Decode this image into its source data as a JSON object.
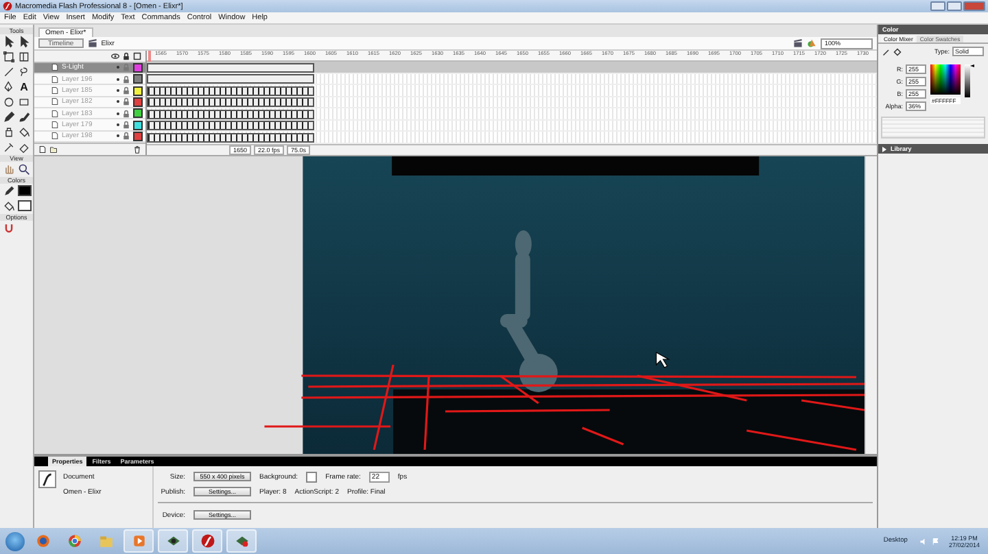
{
  "window": {
    "title": "Macromedia Flash Professional 8 - [Omen - Elixr*]"
  },
  "menu": [
    "File",
    "Edit",
    "View",
    "Insert",
    "Modify",
    "Text",
    "Commands",
    "Control",
    "Window",
    "Help"
  ],
  "tools": {
    "title": "Tools",
    "text_tool": "A",
    "view_label": "View",
    "colors_label": "Colors",
    "options_label": "Options"
  },
  "document_tab": {
    "label": "Omen - Elixr*",
    "selected": true
  },
  "edit_bar": {
    "timeline_button": "Timeline",
    "scene": "Elixr",
    "zoom": "100%"
  },
  "timeline": {
    "ruler": [
      "1565",
      "1570",
      "1575",
      "1580",
      "1585",
      "1590",
      "1595",
      "1600",
      "1605",
      "1610",
      "1615",
      "1620",
      "1625",
      "1630",
      "1635",
      "1640",
      "1645",
      "1650",
      "1655",
      "1660",
      "1665",
      "1670",
      "1675",
      "1680",
      "1685",
      "1690",
      "1695",
      "1700",
      "1705",
      "1710",
      "1715",
      "1720",
      "1725",
      "1730"
    ],
    "layers": [
      {
        "name": "S-Light",
        "selected": true,
        "color": "#e040e0"
      },
      {
        "name": "Layer 196",
        "selected": false,
        "color": "#808080"
      },
      {
        "name": "Layer 185",
        "selected": false,
        "color": "#f0f040"
      },
      {
        "name": "Layer 182",
        "selected": false,
        "color": "#e04040"
      },
      {
        "name": "Layer 183",
        "selected": false,
        "color": "#40d040"
      },
      {
        "name": "Layer 179",
        "selected": false,
        "color": "#40e0e0"
      },
      {
        "name": "Layer 198",
        "selected": false,
        "color": "#e04040"
      }
    ],
    "current_frame": "1650",
    "frame_rate": "22.0 fps",
    "elapsed": "75.0s"
  },
  "color_panel": {
    "title": "Color",
    "tabs": [
      {
        "label": "Color Mixer",
        "selected": true
      },
      {
        "label": "Color Swatches",
        "selected": false
      }
    ],
    "type_label": "Type:",
    "type": "Solid",
    "channels": [
      {
        "label": "R:",
        "value": "255"
      },
      {
        "label": "G:",
        "value": "255"
      },
      {
        "label": "B:",
        "value": "255"
      },
      {
        "label": "Alpha:",
        "value": "36%"
      }
    ],
    "hex": "#FFFFFF",
    "brightness": {
      "level": 1
    }
  },
  "library_panel": {
    "title": "Library",
    "expanded": false
  },
  "properties": {
    "tabs": [
      {
        "label": "Properties",
        "selected": true
      },
      {
        "label": "Filters",
        "selected": false
      },
      {
        "label": "Parameters",
        "selected": false
      }
    ],
    "kind": "Document",
    "name": "Omen - Elixr",
    "size_label": "Size:",
    "size": "550 x 400 pixels",
    "background_label": "Background:",
    "frame_rate_label": "Frame rate:",
    "frame_rate": "22",
    "fps": "fps",
    "publish_label": "Publish:",
    "publish_button": "Settings...",
    "player": "Player: 8",
    "actionscript": "ActionScript: 2",
    "profile": "Profile: Final",
    "device_label": "Device:",
    "device_button": "Settings..."
  },
  "taskbar": {
    "desktop": "Desktop",
    "time": "12:19 PM",
    "date": "27/02/2014"
  }
}
